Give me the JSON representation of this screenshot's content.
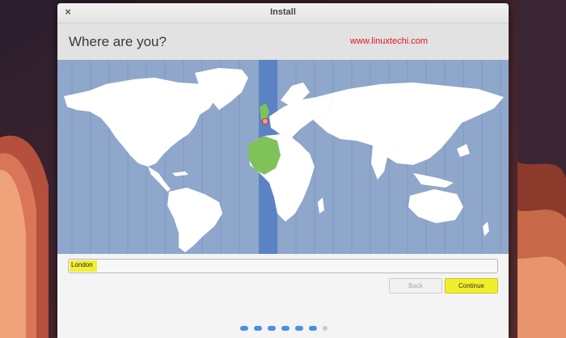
{
  "window": {
    "title": "Install",
    "close_label": "×"
  },
  "header": {
    "title": "Where are you?",
    "watermark": "www.linuxtechi.com"
  },
  "location": {
    "value": "London"
  },
  "buttons": {
    "back": "Back",
    "continue": "Continue"
  },
  "progress": {
    "total_steps": 7,
    "completed_steps": 6
  },
  "colors": {
    "ocean": "#8fa7cb",
    "land": "#ffffff",
    "selected_timezone": "#5b83c4",
    "timezone_region": "#7fc25a",
    "highlight": "#f2ef34",
    "watermark": "#e0141e"
  }
}
